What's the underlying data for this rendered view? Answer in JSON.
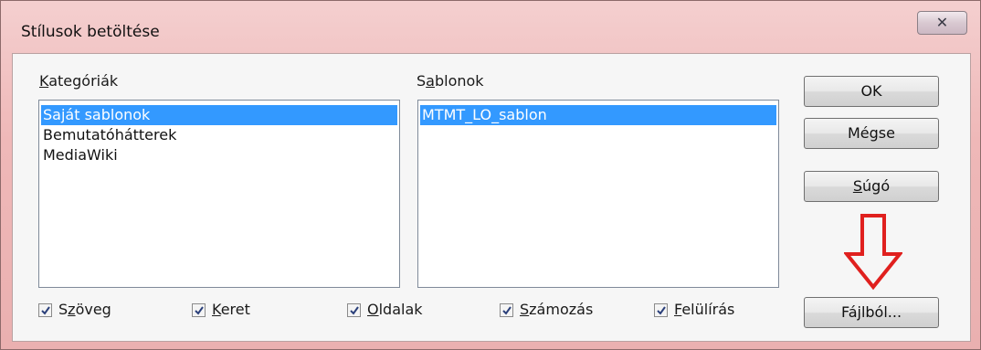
{
  "window": {
    "title": "Stílusok betöltése",
    "close_glyph": "✕"
  },
  "categories": {
    "label_first": "K",
    "label_rest": "ategóriák",
    "items": [
      {
        "label": "Saját sablonok",
        "selected": true
      },
      {
        "label": "Bemutatóhátterek",
        "selected": false
      },
      {
        "label": "MediaWiki",
        "selected": false
      }
    ]
  },
  "templates": {
    "label_first": "S",
    "label_mnemonic": "a",
    "label_rest": "blonok",
    "items": [
      {
        "label": "MTMT_LO_sablon",
        "selected": true
      }
    ]
  },
  "buttons": {
    "ok": "OK",
    "cancel": "Mégse",
    "help_mnemonic": "S",
    "help_rest": "úgó",
    "from_file": "Fájlból..."
  },
  "checkboxes": [
    {
      "before": "S",
      "mnemonic": "z",
      "after": "öveg",
      "checked": true
    },
    {
      "before": "",
      "mnemonic": "K",
      "after": "eret",
      "checked": true
    },
    {
      "before": "",
      "mnemonic": "O",
      "after": "ldalak",
      "checked": true
    },
    {
      "before": "",
      "mnemonic": "S",
      "after": "zámozás",
      "checked": true
    },
    {
      "before": "",
      "mnemonic": "F",
      "after": "elülírás",
      "checked": true
    }
  ],
  "colors": {
    "selection": "#3399ff",
    "annotation_arrow": "#e0201e"
  },
  "icons": {
    "close": "close-icon",
    "arrow": "down-arrow-icon",
    "check": "check-icon"
  }
}
